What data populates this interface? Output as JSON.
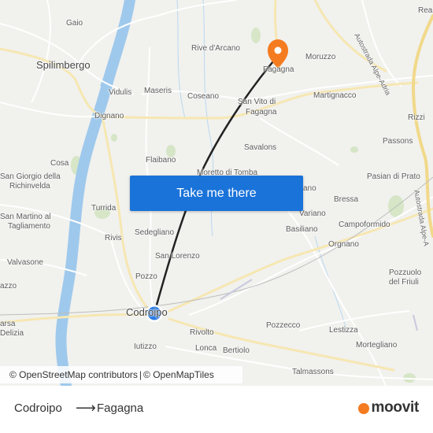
{
  "map": {
    "places": [
      {
        "id": "gaio",
        "label": "Gaio"
      },
      {
        "id": "spilimbergo",
        "label": "Spilimbergo"
      },
      {
        "id": "vidulis",
        "label": "Vidulis"
      },
      {
        "id": "maseris",
        "label": "Maseris"
      },
      {
        "id": "coseano",
        "label": "Coseano"
      },
      {
        "id": "rive-darcano",
        "label": "Rive d'Arcano"
      },
      {
        "id": "fagagna",
        "label": "Fagagna"
      },
      {
        "id": "moruzzo",
        "label": "Moruzzo"
      },
      {
        "id": "martignacco",
        "label": "Martignacco"
      },
      {
        "id": "san-vito-di",
        "label": "San Vito di"
      },
      {
        "id": "fagagna2",
        "label": "Fagagna"
      },
      {
        "id": "dignano",
        "label": "Dignano"
      },
      {
        "id": "rizzi",
        "label": "Rizzi"
      },
      {
        "id": "passons",
        "label": "Passons"
      },
      {
        "id": "savalons",
        "label": "Savalons"
      },
      {
        "id": "flaibano",
        "label": "Flaibano"
      },
      {
        "id": "cosa",
        "label": "Cosa"
      },
      {
        "id": "san-giorgio-1",
        "label": "San Giorgio della"
      },
      {
        "id": "san-giorgio-2",
        "label": "Richinvelda"
      },
      {
        "id": "turrida",
        "label": "Turrida"
      },
      {
        "id": "pasian",
        "label": "Pasian di Prato"
      },
      {
        "id": "bressa",
        "label": "Bressa"
      },
      {
        "id": "variano",
        "label": "Variano"
      },
      {
        "id": "basiliano",
        "label": "Basiliano"
      },
      {
        "id": "campoformido",
        "label": "Campoformido"
      },
      {
        "id": "san-martino-1",
        "label": "San Martino al"
      },
      {
        "id": "san-martino-2",
        "label": "Tagliamento"
      },
      {
        "id": "rivis",
        "label": "Rivis"
      },
      {
        "id": "sedegliano",
        "label": "Sedegliano"
      },
      {
        "id": "orgnano",
        "label": "Orgnano"
      },
      {
        "id": "valvasone",
        "label": "Valvasone"
      },
      {
        "id": "san-lorenzo",
        "label": "San Lorenzo"
      },
      {
        "id": "pozzo",
        "label": "Pozzo"
      },
      {
        "id": "pozzuolo-1",
        "label": "Pozzuolo"
      },
      {
        "id": "pozzuolo-2",
        "label": "del Friuli"
      },
      {
        "id": "codroipo",
        "label": "Codroipo"
      },
      {
        "id": "arsa",
        "label": "arsa"
      },
      {
        "id": "delizia",
        "label": "Delizia"
      },
      {
        "id": "rivolto",
        "label": "Rivolto"
      },
      {
        "id": "pozzecco",
        "label": "Pozzecco"
      },
      {
        "id": "lestizza",
        "label": "Lestizza"
      },
      {
        "id": "lonca",
        "label": "Lonca"
      },
      {
        "id": "bertiolo",
        "label": "Bertiolo"
      },
      {
        "id": "iutizzo",
        "label": "Iutizzo"
      },
      {
        "id": "mortegliano",
        "label": "Mortegliano"
      },
      {
        "id": "talmassons",
        "label": "Talmassons"
      },
      {
        "id": "reana",
        "label": "Rea"
      },
      {
        "id": "moretto",
        "label": "Moretto di Tomba"
      },
      {
        "id": "mereto",
        "label": "ano"
      },
      {
        "id": "azzo",
        "label": "azzo"
      }
    ],
    "road_labels": [
      {
        "id": "a23-north",
        "label": "Autostrada Alpe-Adria"
      },
      {
        "id": "a23-south",
        "label": "Autostrada Alpe-A"
      }
    ],
    "start_marker": "codroipo-origin",
    "end_marker": "fagagna-destination",
    "colors": {
      "route_line": "#222222",
      "start_dot": "#2a7be4",
      "end_pin": "#f47b20",
      "motorway": "#f5e3a8",
      "river": "#9fc9ec"
    }
  },
  "cta": {
    "label": "Take me there"
  },
  "attribution": {
    "osm": "© OpenStreetMap contributors",
    "sep": " | ",
    "omt": "© OpenMapTiles"
  },
  "footer": {
    "from": "Codroipo",
    "arrow": "⟶",
    "to": "Fagagna",
    "brand": "moovit"
  }
}
